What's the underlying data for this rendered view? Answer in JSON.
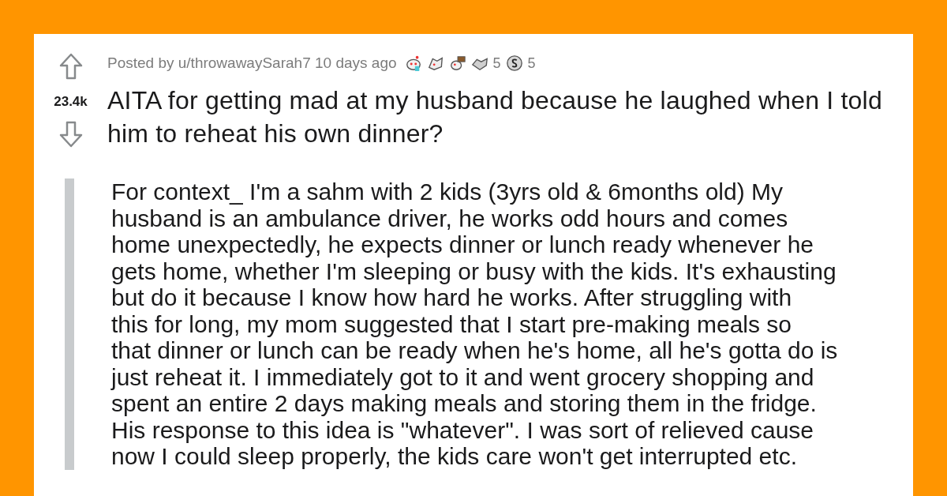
{
  "post": {
    "score": "23.4k",
    "posted_by": "Posted by u/throwawaySarah7 10 days ago",
    "awards": [
      {
        "kind": "robot"
      },
      {
        "kind": "hands"
      },
      {
        "kind": "cart"
      },
      {
        "kind": "handshake",
        "count": "5"
      },
      {
        "kind": "coin",
        "count": "5"
      }
    ],
    "title": "AITA for getting mad at my husband because he laughed when I told him to reheat his own dinner?",
    "body_lines": [
      "For context_ I'm a sahm with 2 kids (3yrs old & 6months old) My",
      "husband is an ambulance driver, he works odd hours and comes",
      "home unexpectedly, he expects dinner or lunch ready whenever he",
      "gets home, whether I'm sleeping or busy with the kids. It's exhausting",
      "but do it because I know how hard he works. After struggling with",
      "this for long, my mom suggested that I start pre-making meals so",
      "that dinner or lunch can be ready when he's home, all he's gotta do is",
      "just reheat it. I immediately got to it and went grocery shopping and",
      "spent an entire 2 days making meals and storing them in the fridge.",
      "His response to this idea is \"whatever\". I was sort of relieved cause",
      "now I could sleep properly, the kids care won't get interrupted etc."
    ]
  }
}
